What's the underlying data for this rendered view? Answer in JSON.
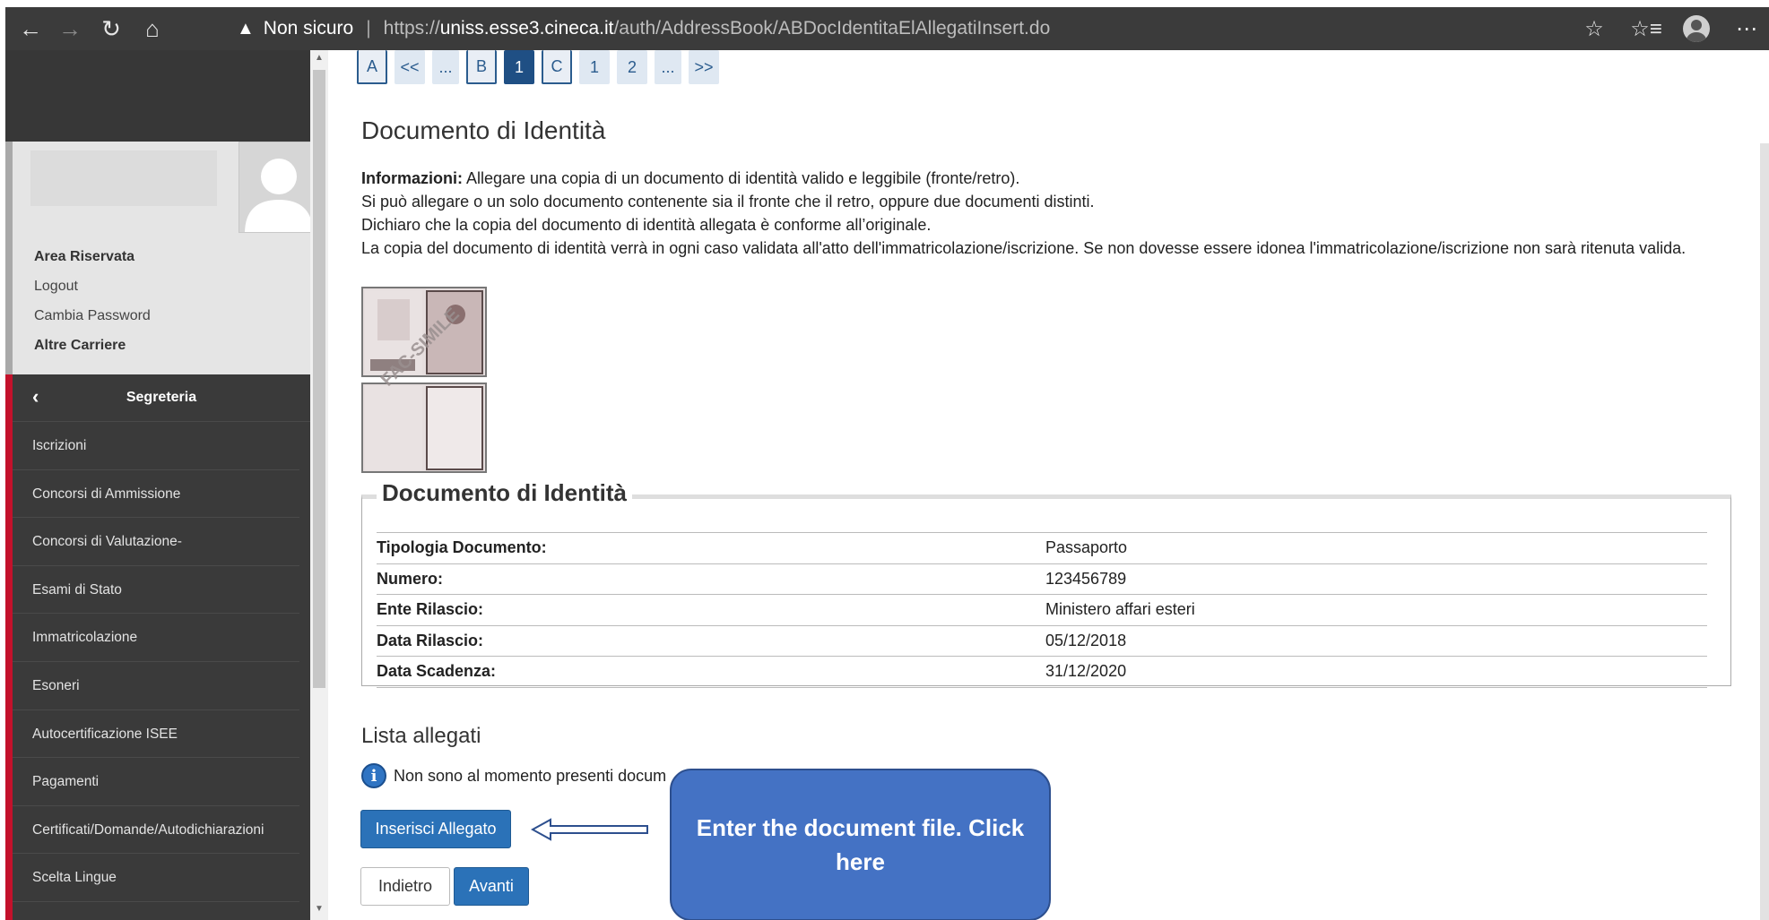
{
  "browser": {
    "security_label": "Non sicuro",
    "url_protocol": "https://",
    "url_host": "uniss.esse3.cineca.it",
    "url_path": "/auth/AddressBook/ABDocIdentitaElAllegatiInsert.do"
  },
  "sidebar": {
    "user_links": {
      "area_riservata": "Area Riservata",
      "logout": "Logout",
      "cambia_password": "Cambia Password",
      "altre_carriere": "Altre Carriere"
    },
    "menu_title": "Segreteria",
    "menu_items": [
      "Iscrizioni",
      "Concorsi di Ammissione",
      "Concorsi di Valutazione-",
      "Esami di Stato",
      "Immatricolazione",
      "Esoneri",
      "Autocertificazione ISEE",
      "Pagamenti",
      "Certificati/Domande/Autodichiarazioni",
      "Scelta Lingue"
    ]
  },
  "pager": [
    "A",
    "<<",
    "...",
    "B",
    "1",
    "C",
    "1",
    "2",
    "...",
    ">>"
  ],
  "main": {
    "title": "Documento di Identità",
    "info_label": "Informazioni:",
    "info_line1": " Allegare una copia di un documento di identità valido e leggibile (fronte/retro).",
    "info_line2": "Si può allegare o un solo documento contenente sia il fronte che il retro, oppure due documenti distinti.",
    "info_line3": "Dichiaro che la copia del documento di identità allegata è conforme all’originale.",
    "info_line4": "La copia del documento di identità verrà in ogni caso validata all'atto dell'immatricolazione/iscrizione. Se non dovesse essere idonea l'immatricolazione/iscrizione non sarà ritenuta valida.",
    "facsimile": "FAC-SIMILE",
    "fieldset_title": "Documento di Identità",
    "table": [
      {
        "label": "Tipologia Documento:",
        "value": "Passaporto"
      },
      {
        "label": "Numero:",
        "value": "123456789"
      },
      {
        "label": "Ente Rilascio:",
        "value": "Ministero affari esteri"
      },
      {
        "label": "Data Rilascio:",
        "value": "05/12/2018"
      },
      {
        "label": "Data Scadenza:",
        "value": "31/12/2020"
      }
    ],
    "lista_title": "Lista allegati",
    "lista_empty": "Non sono al momento presenti docum",
    "btn_inserisci": "Inserisci Allegato",
    "btn_indietro": "Indietro",
    "btn_avanti": "Avanti"
  },
  "callout": "Enter the document file. Click here"
}
